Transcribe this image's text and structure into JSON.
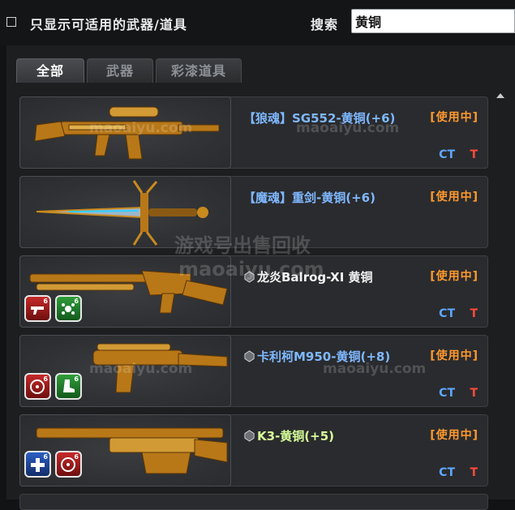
{
  "filter": {
    "label": "只显示可适用的武器/道具",
    "checked": false
  },
  "search": {
    "label": "搜索",
    "value": "黄铜"
  },
  "tabs": [
    {
      "label": "全部",
      "active": true
    },
    {
      "label": "武器",
      "active": false
    },
    {
      "label": "彩漆道具",
      "active": false
    }
  ],
  "items": [
    {
      "name": "【狼魂】SG552-黄铜(+6)",
      "status": "[使用中]",
      "ct": "CT",
      "t": "T",
      "name_color": "blue",
      "gem": false,
      "badges": []
    },
    {
      "name": "【魔魂】重剑-黄铜(+6)",
      "status": "[使用中]",
      "ct": "",
      "t": "",
      "name_color": "blue",
      "gem": false,
      "badges": []
    },
    {
      "name": "龙炎Balrog-XI 黄铜",
      "status": "[使用中]",
      "ct": "CT",
      "t": "T",
      "name_color": "white",
      "gem": true,
      "badges": [
        {
          "color": "red",
          "icon": "gun-icon",
          "level": "6"
        },
        {
          "color": "green",
          "icon": "splash-icon",
          "level": "6"
        }
      ]
    },
    {
      "name": "卡利柯M950-黄铜(+8)",
      "status": "[使用中]",
      "ct": "CT",
      "t": "T",
      "name_color": "blue",
      "gem": true,
      "badges": [
        {
          "color": "red",
          "icon": "crosshair-icon",
          "level": "6"
        },
        {
          "color": "green",
          "icon": "boot-icon",
          "level": "6"
        }
      ]
    },
    {
      "name": "K3-黄铜(+5)",
      "status": "[使用中]",
      "ct": "CT",
      "t": "T",
      "name_color": "green",
      "gem": true,
      "badges": [
        {
          "color": "blue",
          "icon": "plus-icon",
          "level": "6"
        },
        {
          "color": "red",
          "icon": "crosshair-icon",
          "level": "6"
        }
      ]
    }
  ],
  "watermarks": {
    "site": "maoaiyu.com",
    "tagline": "游戏号出售回收"
  },
  "colors": {
    "name_blue": "#7fb8ff",
    "name_green": "#d8ff9a",
    "status_orange": "#ff9a2e",
    "ct_blue": "#5ea8ff",
    "t_red": "#ff4a3a",
    "gold": "#c98a1e"
  }
}
